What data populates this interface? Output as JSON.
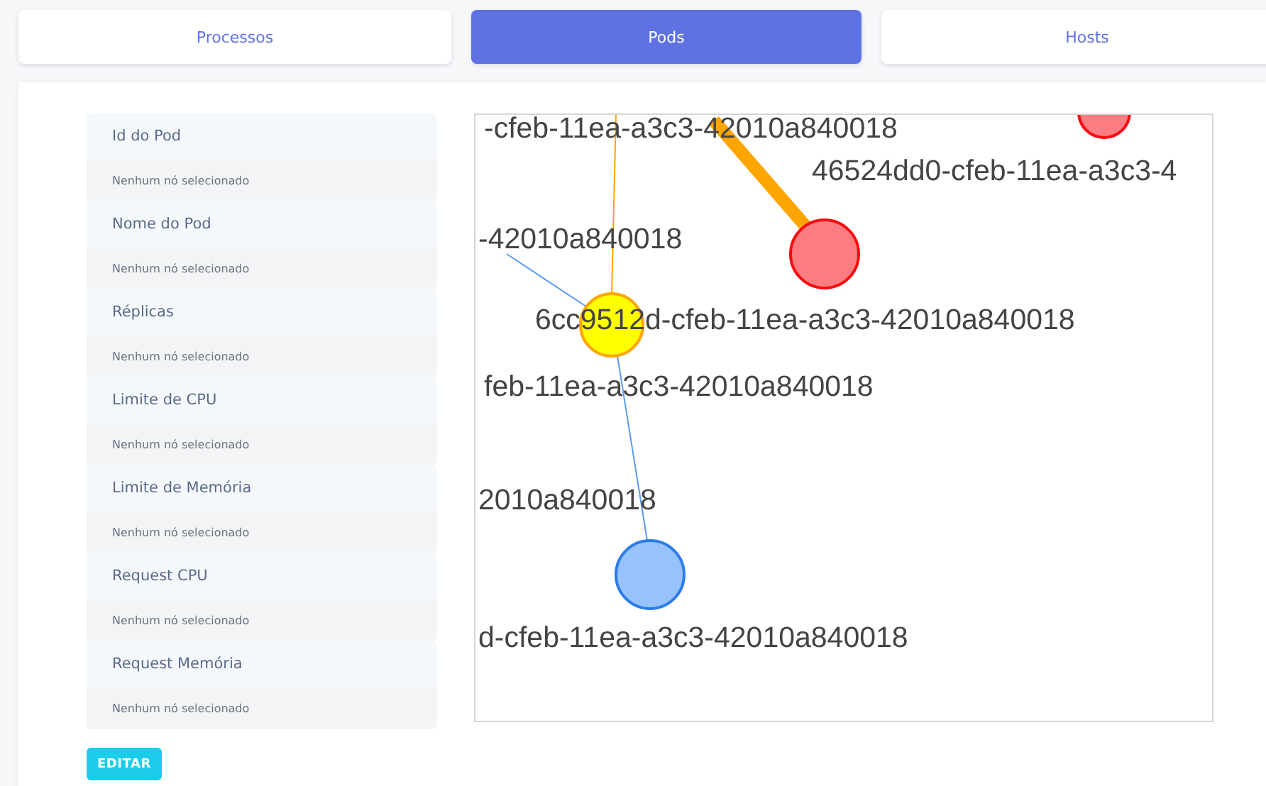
{
  "tabs": [
    {
      "label": "Processos",
      "selected": false
    },
    {
      "label": "Pods",
      "selected": true
    },
    {
      "label": "Hosts",
      "selected": false
    }
  ],
  "details": [
    {
      "label": "Id do Pod",
      "value": "Nenhum nó selecionado"
    },
    {
      "label": "Nome do Pod",
      "value": "Nenhum nó selecionado"
    },
    {
      "label": "Réplicas",
      "value": "Nenhum nó selecionado"
    },
    {
      "label": "Limite de CPU",
      "value": "Nenhum nó selecionado"
    },
    {
      "label": "Limite de Memória",
      "value": "Nenhum nó selecionado"
    },
    {
      "label": "Request CPU",
      "value": "Nenhum nó selecionado"
    },
    {
      "label": "Request Memória",
      "value": "Nenhum nó selecionado"
    }
  ],
  "edit_button": "EDITAR",
  "graph": {
    "nodes": [
      {
        "color": "#fb7c81"
      },
      {
        "color": "#fb7c81"
      },
      {
        "color": "#ffff00"
      },
      {
        "color": "#97c2fc"
      }
    ],
    "labels": [
      "-cfeb-11ea-a3c3-42010a840018",
      "46524dd0-cfeb-11ea-a3c3-4",
      "-42010a840018",
      "6cc9512d-cfeb-11ea-a3c3-42010a840018",
      "feb-11ea-a3c3-42010a840018",
      "2010a840018",
      "d-cfeb-11ea-a3c3-42010a840018"
    ]
  }
}
